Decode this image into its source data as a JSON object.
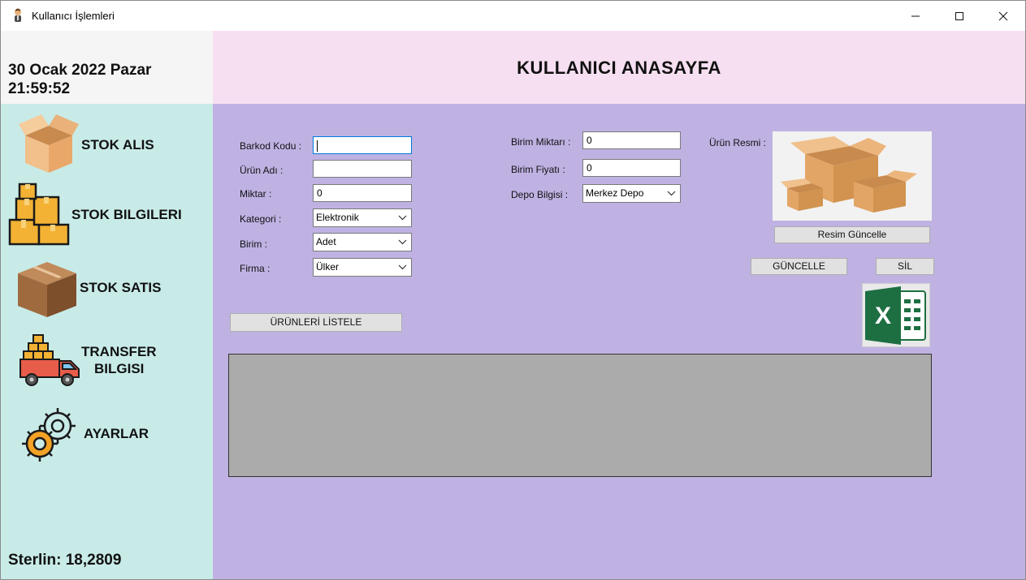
{
  "window": {
    "title": "Kullanıcı İşlemleri",
    "minimize_glyph": "—",
    "maximize_glyph": "☐",
    "close_glyph": "✕"
  },
  "status": {
    "date": "30 Ocak 2022 Pazar",
    "time": "21:59:52",
    "currency": "Sterlin: 18,2809"
  },
  "header": {
    "title": "KULLANICI ANASAYFA"
  },
  "sidebar": {
    "items": [
      {
        "label": "STOK ALIS",
        "icon": "open-box-icon"
      },
      {
        "label": "STOK BILGILERI",
        "icon": "stacked-boxes-icon"
      },
      {
        "label": "STOK SATIS",
        "icon": "closed-box-icon"
      },
      {
        "label": "TRANSFER",
        "label2": "BILGISI",
        "icon": "delivery-truck-icon"
      },
      {
        "label": "AYARLAR",
        "icon": "gears-icon"
      }
    ]
  },
  "form": {
    "barcode_label": "Barkod Kodu :",
    "barcode_value": "",
    "product_name_label": "Ürün Adı :",
    "product_name_value": "",
    "quantity_label": "Miktar :",
    "quantity_value": "0",
    "category_label": "Kategori :",
    "category_value": "Elektronik",
    "unit_label": "Birim :",
    "unit_value": "Adet",
    "company_label": "Firma :",
    "company_value": "Ülker",
    "unit_amount_label": "Birim Miktarı :",
    "unit_amount_value": "0",
    "unit_price_label": "Birim Fiyatı :",
    "unit_price_value": "0",
    "warehouse_label": "Depo Bilgisi :",
    "warehouse_value": "Merkez Depo",
    "image_label": "Ürün Resmi :"
  },
  "buttons": {
    "update_image": "Resim Güncelle",
    "update": "GÜNCELLE",
    "delete": "SİL",
    "list_products": "ÜRÜNLERİ LİSTELE"
  },
  "icons": {
    "excel": "excel-icon",
    "product_image": "cardboard-boxes-image",
    "dropdown": "chevron-down-icon"
  },
  "colors": {
    "header_bg": "#f6dff0",
    "sidebar_bg": "#c8ebe8",
    "main_bg": "#bfb2e3",
    "grid_bg": "#ababab",
    "excel_green": "#1d6f42"
  }
}
